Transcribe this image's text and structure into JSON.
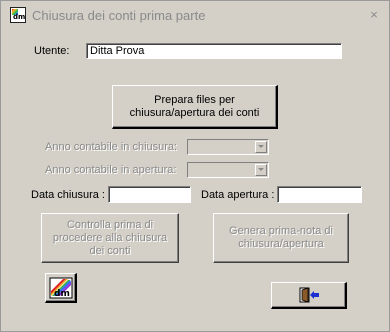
{
  "window": {
    "title": "Chiusura dei conti prima parte",
    "close_glyph": "×"
  },
  "form": {
    "user_label": "Utente:",
    "user_value": "Ditta Prova",
    "prepare_button": "Prepara files per chiusura/apertura dei conti",
    "year_closing_label": "Anno contabile in chiusura:",
    "year_opening_label": "Anno contabile in apertura:",
    "closing_date_label": "Data chiusura :",
    "closing_date_value": "",
    "opening_date_label": "Data apertura :",
    "opening_date_value": "",
    "check_button": "Controlla prima di procedere alla chiusura dei conti",
    "generate_button": "Genera prima-nota di chiusura/apertura"
  },
  "icons": {
    "app_icon": "dm-logo-icon",
    "app_icon_text": "dm",
    "logo_button_icon": "dm-logo-icon",
    "exit_button_icon": "exit-door-icon"
  },
  "colors": {
    "window_bg": "#d4d0c8",
    "disabled_text": "#8a8a8a",
    "exit_arrow": "#1a2fd1",
    "exit_door": "#8b5a2b"
  }
}
